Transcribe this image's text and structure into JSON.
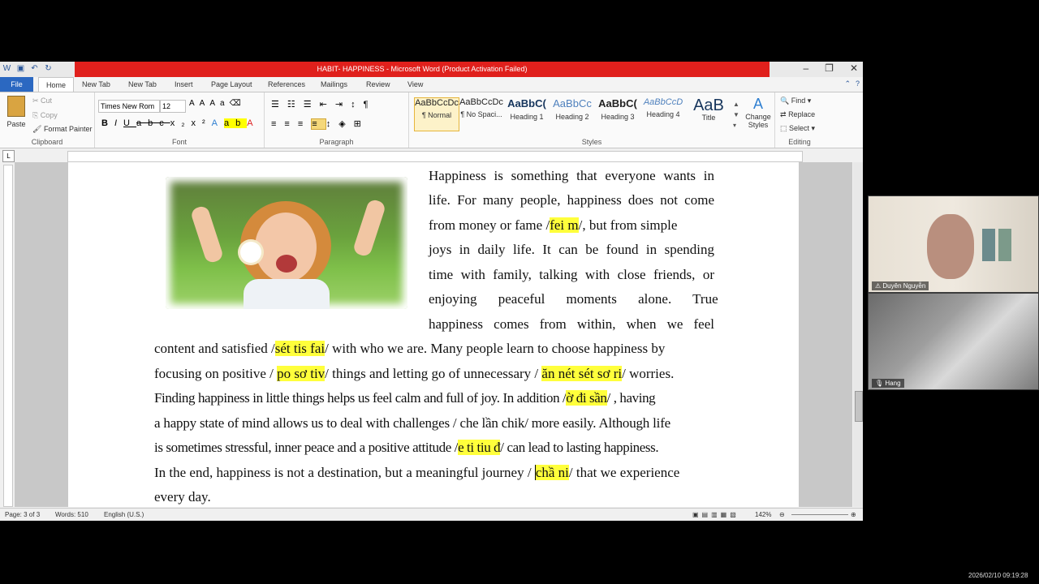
{
  "window": {
    "title": "HABIT- HAPPINESS  -  Microsoft Word (Product Activation Failed)",
    "minimize": "–",
    "restore": "❐",
    "close": "✕"
  },
  "ribbon_tabs": [
    "File",
    "Home",
    "New Tab",
    "New Tab",
    "Insert",
    "Page Layout",
    "References",
    "Mailings",
    "Review",
    "View"
  ],
  "clipboard": {
    "paste": "Paste",
    "cut": "Cut",
    "copy": "Copy",
    "format_painter": "Format Painter",
    "label": "Clipboard"
  },
  "font": {
    "name": "Times New Rom",
    "size": "12",
    "label": "Font"
  },
  "paragraph": {
    "label": "Paragraph"
  },
  "styles": {
    "items": [
      {
        "preview": "AaBbCcDc",
        "name": "¶ Normal"
      },
      {
        "preview": "AaBbCcDc",
        "name": "¶ No Spaci..."
      },
      {
        "preview": "AaBbC(",
        "name": "Heading 1"
      },
      {
        "preview": "AaBbCc",
        "name": "Heading 2"
      },
      {
        "preview": "AaBbC(",
        "name": "Heading 3"
      },
      {
        "preview": "AaBbCcD",
        "name": "Heading 4"
      },
      {
        "preview": "AaB",
        "name": "Title"
      }
    ],
    "change_styles": "Change Styles",
    "label": "Styles"
  },
  "editing": {
    "find": "Find",
    "replace": "Replace",
    "select": "Select",
    "label": "Editing"
  },
  "document": {
    "lines": [
      [
        "Happiness is something that everyone wants in"
      ],
      [
        "life. For many people, happiness does not come"
      ],
      [
        "from money or fame /",
        "fei m",
        "/, but from simple"
      ],
      [
        "joys in daily life. It can be found in spending"
      ],
      [
        "time with family, talking with close friends, or"
      ],
      [
        "enjoying peaceful moments alone. True"
      ],
      [
        "happiness comes from within, when we feel"
      ],
      [
        "content and satisfied /",
        "sét tis fai",
        "/ with who we are. Many people learn to choose happiness by"
      ],
      [
        "focusing on positive / ",
        "po sơ tiv",
        "/ things and letting go of unnecessary / ",
        "ăn nét sét sơ ri",
        "/ worries."
      ],
      [
        "Finding happiness in little things helps us feel calm and full of joy. In addition /",
        "ờ đi sần",
        "/ , having"
      ],
      [
        "a happy state of mind allows us to deal with challenges / che lần chik/ more easily. Although life"
      ],
      [
        "is sometimes stressful, inner peace and a positive attitude /",
        "e ti tiu đ",
        "/ can lead to lasting happiness."
      ],
      [
        "In the end, happiness is not a destination, but a meaningful journey / ",
        "chầ ni",
        "/ that we experience"
      ],
      [
        "every day."
      ]
    ]
  },
  "status_bar": {
    "page": "Page: 3 of 3",
    "words": "Words: 510",
    "language": "English (U.S.)",
    "zoom": "142%"
  },
  "participants": [
    {
      "name": "Duyên Nguyễn"
    },
    {
      "name": "Hang"
    }
  ],
  "timestamp": "2026/02/10 09:19:28"
}
